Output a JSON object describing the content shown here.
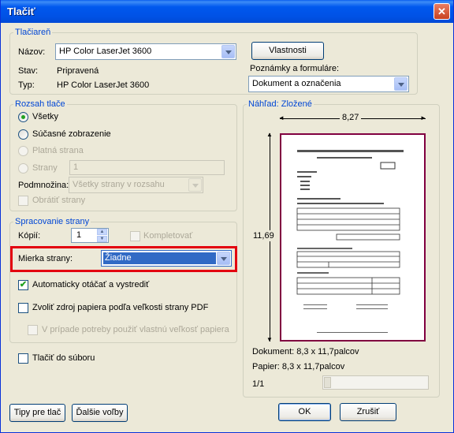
{
  "window": {
    "title": "Tlačiť",
    "close_glyph": "✕"
  },
  "printer": {
    "legend": "Tlačiareň",
    "name_label": "Názov:",
    "name_value": "HP Color LaserJet 3600",
    "properties_button": "Vlastnosti",
    "status_label": "Stav:",
    "status_value": "Pripravená",
    "type_label": "Typ:",
    "type_value": "HP Color LaserJet 3600",
    "comments_label": "Poznámky a formuláre:",
    "comments_value": "Dokument a označenia"
  },
  "range": {
    "legend": "Rozsah tlače",
    "all": "Všetky",
    "current_view": "Súčasné zobrazenie",
    "current_page": "Platná strana",
    "pages": "Strany",
    "pages_value": "1",
    "subset_label": "Podmnožina:",
    "subset_value": "Všetky strany v rozsahu",
    "reverse": "Obrátiť strany"
  },
  "handling": {
    "legend": "Spracovanie strany",
    "copies_label": "Kópií:",
    "copies_value": "1",
    "collate": "Kompletovať",
    "scaling_label": "Mierka strany:",
    "scaling_value": "Žiadne",
    "autorotate": "Automaticky otáčať a vystrediť",
    "choose_source": "Zvoliť zdroj papiera podľa veľkosti strany PDF",
    "custom_size": "V prípade potreby použiť vlastnú veľkosť papiera"
  },
  "print_to_file": "Tlačiť do súboru",
  "preview": {
    "legend": "Náhľad: Zložené",
    "width": "8,27",
    "height": "11,69",
    "document_size": "Dokument: 8,3 x 11,7palcov",
    "paper_size": "Papier: 8,3 x 11,7palcov",
    "page_counter": "1/1"
  },
  "buttons": {
    "tips": "Tipy pre tlač",
    "advanced": "Ďalšie voľby",
    "ok": "OK",
    "cancel": "Zrušiť"
  },
  "colors": {
    "highlight_box": "#e3000f",
    "selection": "#316ac5"
  }
}
